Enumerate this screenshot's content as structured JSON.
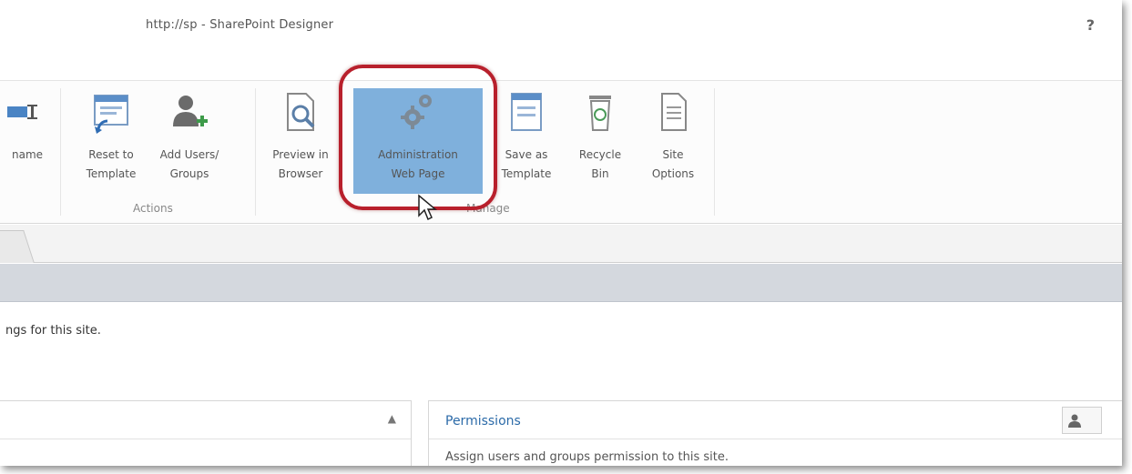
{
  "window": {
    "title": "http://sp - SharePoint Designer",
    "help_label": "?"
  },
  "ribbon": {
    "buttons": [
      {
        "name": "rename",
        "line1": "name",
        "line2": ""
      },
      {
        "name": "reset-to-template",
        "line1": "Reset to",
        "line2": "Template"
      },
      {
        "name": "add-users-groups",
        "line1": "Add Users/",
        "line2": "Groups"
      },
      {
        "name": "preview-in-browser",
        "line1": "Preview in",
        "line2": "Browser"
      },
      {
        "name": "administration-web-page",
        "line1": "Administration",
        "line2": "Web Page"
      },
      {
        "name": "save-as-template",
        "line1": "Save as",
        "line2": "Template"
      },
      {
        "name": "recycle-bin",
        "line1": "Recycle",
        "line2": "Bin"
      },
      {
        "name": "site-options",
        "line1": "Site",
        "line2": "Options"
      }
    ],
    "groups": {
      "actions": "Actions",
      "manage": "Manage"
    }
  },
  "content": {
    "description": "ngs for this site."
  },
  "panels": {
    "permissions": {
      "title": "Permissions",
      "description": "Assign users and groups permission to this site."
    }
  },
  "colors": {
    "highlight": "#7fb0dc",
    "callout_ring": "#b8202c",
    "link": "#2b6aa8"
  }
}
